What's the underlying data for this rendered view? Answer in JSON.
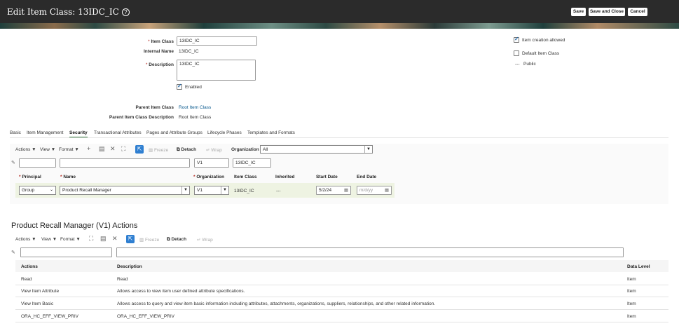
{
  "header": {
    "title": "Edit Item Class: 13IDC_IC",
    "buttons": {
      "save": "Save",
      "save_close": "Save and Close",
      "cancel": "Cancel"
    }
  },
  "form": {
    "item_class_label": "Item Class",
    "item_class_value": "13IDC_IC",
    "internal_name_label": "Internal Name",
    "internal_name_value": "13IDC_IC",
    "description_label": "Description",
    "description_value": "13IDC_IC",
    "enabled_label": "Enabled",
    "enabled_checked": true,
    "parent_item_class_label": "Parent Item Class",
    "parent_item_class_value": "Root Item Class",
    "parent_desc_label": "Parent Item Class Description",
    "parent_desc_value": "Root Item Class",
    "item_creation_allowed_label": "Item creation allowed",
    "item_creation_allowed_checked": true,
    "default_item_class_label": "Default Item Class",
    "default_item_class_checked": false,
    "public_label": "Public",
    "public_value": "---"
  },
  "tabs": [
    {
      "label": "Basic"
    },
    {
      "label": "Item Management"
    },
    {
      "label": "Security",
      "active": true
    },
    {
      "label": "Transactional Attributes"
    },
    {
      "label": "Pages and Attribute Groups"
    },
    {
      "label": "Lifecycle Phases"
    },
    {
      "label": "Templates and Formats"
    }
  ],
  "toolbar1": {
    "actions": "Actions ▼",
    "view": "View ▼",
    "format": "Format ▼",
    "freeze": "Freeze",
    "detach": "Detach",
    "wrap": "Wrap",
    "organization_label": "Organization",
    "organization_value": "All"
  },
  "security_table": {
    "filter_org": "V1",
    "filter_item_class": "13IDC_IC",
    "headers": {
      "principal": "Principal",
      "name": "Name",
      "organization": "Organization",
      "item_class": "Item Class",
      "inherited": "Inherited",
      "start_date": "Start Date",
      "end_date": "End Date"
    },
    "row": {
      "principal": "Group",
      "name": "Product Recall Manager",
      "organization": "V1",
      "item_class": "13IDC_IC",
      "inherited": "---",
      "start_date": "5/2/24",
      "end_date_placeholder": "m/d/yy"
    }
  },
  "actions_section": {
    "title": "Product Recall Manager (V1) Actions",
    "toolbar": {
      "actions": "Actions ▼",
      "view": "View ▼",
      "format": "Format ▼",
      "freeze": "Freeze",
      "detach": "Detach",
      "wrap": "Wrap"
    },
    "headers": {
      "actions": "Actions",
      "description": "Description",
      "data_level": "Data Level"
    },
    "rows": [
      {
        "action": "Read",
        "description": "Read",
        "level": "Item"
      },
      {
        "action": "View Item Attribute",
        "description": "Allows access to view item user defined attribute specifications.",
        "level": "Item"
      },
      {
        "action": "View Item Basic",
        "description": "Allows access to query and view item basic information including attributes, attachments, organizations, suppliers, relationships, and other related information.",
        "level": "Item"
      },
      {
        "action": "ORA_HC_EFF_VIEW_PRIV",
        "description": "ORA_HC_EFF_VIEW_PRIV",
        "level": "Item"
      }
    ]
  }
}
